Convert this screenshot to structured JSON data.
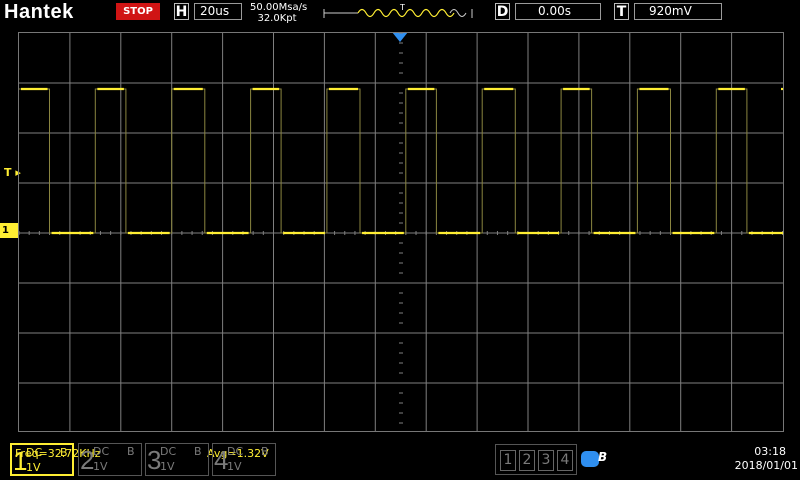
{
  "header": {
    "brand": "Hantek",
    "run_state": "STOP",
    "timebase_key": "H",
    "timebase_value": "20us",
    "sample_rate": "50.00Msa/s",
    "memory_depth": "32.0Kpt",
    "trigger_marker_label": "T",
    "delay_key": "D",
    "delay_value": "0.00s",
    "trigger_key": "T",
    "trigger_value": "920mV"
  },
  "screen": {
    "trigger_level_label": "T",
    "channel1_ground_label": "1",
    "measurements": {
      "frequency": "Freq=32.72KHz",
      "average": "Avg=1.32V"
    }
  },
  "channels": [
    {
      "number": "1",
      "coupling": "DC",
      "bw": "B",
      "scale": "1V"
    },
    {
      "number": "2",
      "coupling": "DC",
      "bw": "B",
      "scale": "1V"
    },
    {
      "number": "3",
      "coupling": "DC",
      "bw": "B",
      "scale": "1V"
    },
    {
      "number": "4",
      "coupling": "DC",
      "bw": "B",
      "scale": "1V"
    }
  ],
  "channel_select": [
    "1",
    "2",
    "3",
    "4"
  ],
  "usb_letter": "B",
  "status": {
    "time": "03:18",
    "date": "2018/01/01"
  },
  "waveform": {
    "channel": "1",
    "shape": "square",
    "high_divisions": 3.0,
    "low_divisions": 0.0,
    "edges_in_divisions": [
      0.6,
      1.5,
      2.1,
      3.0,
      3.65,
      4.55,
      5.15,
      6.05,
      6.7,
      7.6,
      8.2,
      9.1,
      9.75,
      10.65,
      11.25,
      12.15,
      12.8,
      13.7,
      14.3,
      15.2
    ],
    "colors": {
      "trace": "#ffee33",
      "grid": "#7f7f7f",
      "marker": "#2f8ff0",
      "stop": "#d01414"
    }
  }
}
